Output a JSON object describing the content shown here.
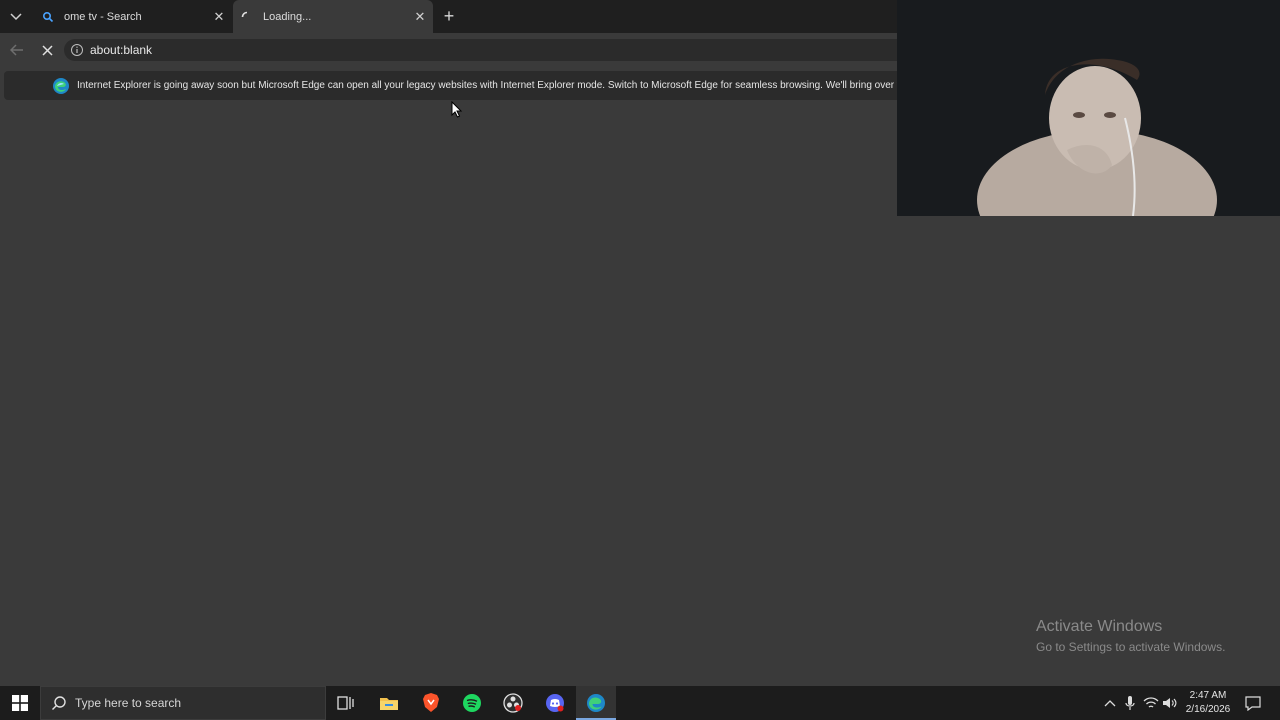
{
  "browser": {
    "tabs": [
      {
        "title": "ome tv - Search",
        "favicon": "search-icon"
      },
      {
        "title": "Loading...",
        "favicon": "loading-spinner-icon"
      }
    ],
    "address_url": "about:blank",
    "infobar_message": "Internet Explorer is going away soon but Microsoft Edge can open all your legacy websites with Internet Explorer mode. Switch to Microsoft Edge for seamless browsing. We'll bring over yo"
  },
  "watermark": {
    "title": "Activate Windows",
    "subtitle": "Go to Settings to activate Windows."
  },
  "taskbar": {
    "search_placeholder": "Type here to search",
    "time": "2:47 AM",
    "date": "2/16/2026",
    "pinned": [
      "task-view-icon",
      "file-explorer-icon",
      "brave-icon",
      "spotify-icon",
      "obs-icon",
      "discord-icon",
      "edge-icon"
    ]
  },
  "colors": {
    "titlebar": "#1f1f1f",
    "page_bg": "#3a3a3a",
    "taskbar": "#1c1c1c",
    "accent": "#7aa7e0"
  }
}
